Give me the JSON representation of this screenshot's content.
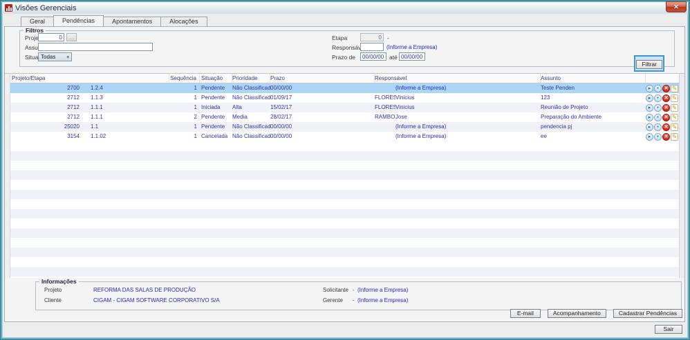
{
  "window": {
    "title": "Visões Gerenciais"
  },
  "icons": {
    "close": "✕",
    "browse": "...",
    "chevron_down": "▾",
    "row_open": "▸",
    "row_view": "•",
    "row_delete": "✕",
    "row_edit": "✎"
  },
  "tabs": [
    {
      "label": "Geral"
    },
    {
      "label": "Pendências"
    },
    {
      "label": "Apontamentos"
    },
    {
      "label": "Alocações"
    }
  ],
  "filters": {
    "legend": "Filtros",
    "projeto_label": "Projeto",
    "projeto_value": "0",
    "assunto_label": "Assunto",
    "assunto_value": "",
    "situacao_label": "Situação",
    "situacao_value": "Todas",
    "etapa_label": "Etapa",
    "etapa_value": "0",
    "etapa_suffix": "-",
    "responsavel_label": "Responsável",
    "responsavel_value": "",
    "responsavel_link": "(Informe a Empresa)",
    "prazo_label": "Prazo de",
    "prazo_de": "00/00/00",
    "ate_label": "até",
    "prazo_ate": "00/00/00",
    "filtrar_label": "Filtrar"
  },
  "grid": {
    "headers": {
      "projeto_etapa": "Projeto/Etapa",
      "sequencia": "Sequência",
      "situacao": "Situação",
      "prioridade": "Prioridade",
      "prazo": "Prazo",
      "responsavel": "Responsável",
      "assunto": "Assunto"
    },
    "rows": [
      {
        "projeto": "2700",
        "etapa": "1.2.4",
        "seq": "1",
        "situacao": "Pendente",
        "prioridade": "Não Classificada",
        "prazo": "00/00/00",
        "resp_code": "",
        "resp_name": "",
        "resp_link": "(Informe a Empresa)",
        "assunto": "Teste Penden"
      },
      {
        "projeto": "2712",
        "etapa": "1.1.3",
        "seq": "1",
        "situacao": "Pendente",
        "prioridade": "Não Classificada",
        "prazo": "01/09/17",
        "resp_code": "FLORES",
        "resp_name": "Vinicius",
        "resp_link": "",
        "assunto": "123"
      },
      {
        "projeto": "2712",
        "etapa": "1.1.1",
        "seq": "1",
        "situacao": "Iniciada",
        "prioridade": "Alta",
        "prazo": "15/02/17",
        "resp_code": "FLORES",
        "resp_name": "Vinicius",
        "resp_link": "",
        "assunto": "Reunião de Projeto"
      },
      {
        "projeto": "2712",
        "etapa": "1.1.1",
        "seq": "2",
        "situacao": "Pendente",
        "prioridade": "Media",
        "prazo": "28/02/17",
        "resp_code": "RAMBO",
        "resp_name": "Jose",
        "resp_link": "",
        "assunto": "Preparação do Ambiente"
      },
      {
        "projeto": "25020",
        "etapa": "1.1",
        "seq": "1",
        "situacao": "Pendente",
        "prioridade": "Não Classificada",
        "prazo": "00/00/00",
        "resp_code": "",
        "resp_name": "",
        "resp_link": "(Informe a Empresa)",
        "assunto": "pendencia pj"
      },
      {
        "projeto": "3154",
        "etapa": "1.1.02",
        "seq": "1",
        "situacao": "Cancelada",
        "prioridade": "Não Classificada",
        "prazo": "00/00/00",
        "resp_code": "",
        "resp_name": "",
        "resp_link": "(Informe a Empresa)",
        "assunto": "ee"
      }
    ]
  },
  "info": {
    "legend": "Informações",
    "projeto_label": "Projeto",
    "projeto_value": "REFORMA DAS SALAS DE PRODUÇÃO",
    "cliente_label": "Cliente",
    "cliente_value": "CIGAM - CIGAM SOFTWARE CORPORATIVO S/A",
    "solicitante_label": "Solicitante",
    "solicitante_dash": "-",
    "solicitante_link": "(Informe a Empresa)",
    "gerente_label": "Gerente",
    "gerente_dash": "-",
    "gerente_link": "(Informe a Empresa)"
  },
  "buttons": {
    "email": "E-mail",
    "acompanhamento": "Acompanhamento",
    "cadastrar": "Cadastrar Pendências",
    "sair": "Sair"
  },
  "colors": {
    "frame": "#64abc0",
    "selected_row": "#abd6f5",
    "alt_row": "#f1f1f8",
    "data_text": "#3434a4",
    "link": "#2626d8",
    "focus_ring": "#3c97d4",
    "close_red": "#c65238"
  }
}
